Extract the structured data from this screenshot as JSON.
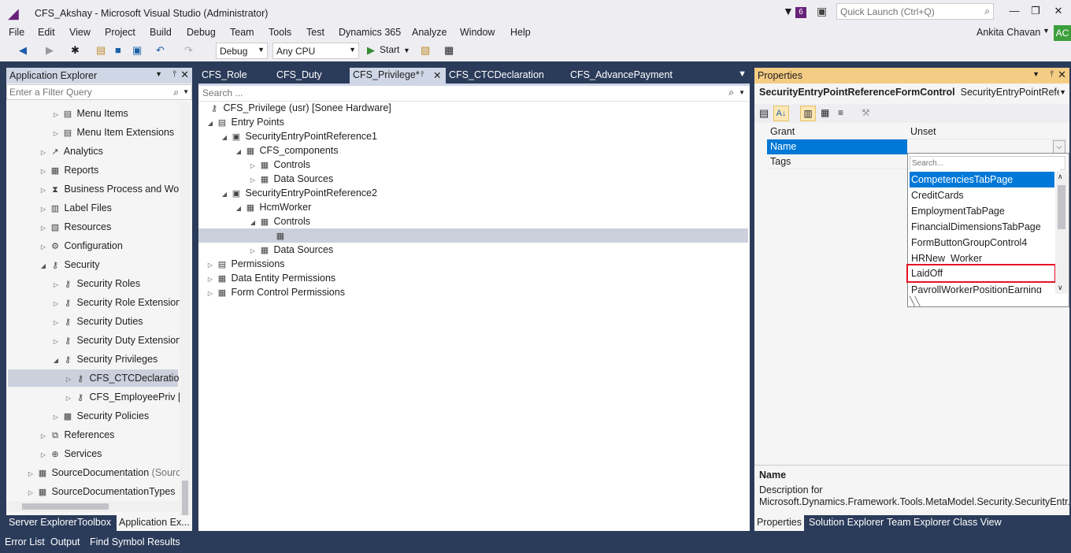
{
  "window": {
    "title": "CFS_Akshay - Microsoft Visual Studio (Administrator)",
    "notification_count": "6",
    "quick_launch_placeholder": "Quick Launch (Ctrl+Q)"
  },
  "menu": [
    "File",
    "Edit",
    "View",
    "Project",
    "Build",
    "Debug",
    "Team",
    "Tools",
    "Test",
    "Dynamics 365",
    "Analyze",
    "Window",
    "Help"
  ],
  "user": {
    "name": "Ankita Chavan",
    "initials": "AC"
  },
  "toolbar": {
    "config": "Debug",
    "platform": "Any CPU",
    "start": "Start"
  },
  "app_explorer": {
    "title": "Application Explorer",
    "filter_placeholder": "Enter a Filter Query",
    "items": [
      {
        "label": "Menu Items"
      },
      {
        "label": "Menu Item Extensions"
      },
      {
        "label": "Analytics"
      },
      {
        "label": "Reports"
      },
      {
        "label": "Business Process and Work"
      },
      {
        "label": "Label Files"
      },
      {
        "label": "Resources"
      },
      {
        "label": "Configuration"
      },
      {
        "label": "Security"
      },
      {
        "label": "Security Roles"
      },
      {
        "label": "Security Role Extensions"
      },
      {
        "label": "Security Duties"
      },
      {
        "label": "Security Duty Extensions"
      },
      {
        "label": "Security Privileges"
      },
      {
        "label": "CFS_CTCDeclaration"
      },
      {
        "label": "CFS_EmployeePriv"
      },
      {
        "label": "Security Policies"
      },
      {
        "label": "References"
      },
      {
        "label": "Services"
      },
      {
        "label": "SourceDocumentation",
        "suffix": "(Sourc"
      },
      {
        "label": "SourceDocumentationTypes"
      }
    ],
    "bottom_tabs": [
      "Server Explorer",
      "Toolbox",
      "Application Ex..."
    ]
  },
  "editor": {
    "tabs": [
      "CFS_Role",
      "CFS_Duty",
      "CFS_Privilege*",
      "CFS_CTCDeclaration",
      "CFS_AdvancePayment"
    ],
    "search_placeholder": "Search ...",
    "tree": [
      {
        "label": "CFS_Privilege (usr) [Sonee Hardware]"
      },
      {
        "label": "Entry Points"
      },
      {
        "label": "SecurityEntryPointReference1"
      },
      {
        "label": "CFS_components"
      },
      {
        "label": "Controls"
      },
      {
        "label": "Data Sources"
      },
      {
        "label": "SecurityEntryPointReference2"
      },
      {
        "label": "HcmWorker"
      },
      {
        "label": "Controls"
      },
      {
        "label": ""
      },
      {
        "label": "Data Sources"
      },
      {
        "label": "Permissions"
      },
      {
        "label": "Data Entity Permissions"
      },
      {
        "label": "Form Control Permissions"
      }
    ]
  },
  "properties": {
    "title": "Properties",
    "object_name": "SecurityEntryPointReferenceFormControl",
    "object_type": "SecurityEntryPointReferenc",
    "rows": [
      {
        "key": "Grant",
        "value": "Unset"
      },
      {
        "key": "Name",
        "value": ""
      },
      {
        "key": "Tags",
        "value": ""
      }
    ],
    "dropdown_search_placeholder": "Search...",
    "options": [
      "CompetenciesTabPage",
      "CreditCards",
      "EmploymentTabPage",
      "FinancialDimensionsTabPage",
      "FormButtonGroupControl4",
      "HRNew_Worker",
      "LaidOff",
      "PayrollWorkerPositionEarning"
    ],
    "desc_title": "Name",
    "desc_text": "Description for Microsoft.Dynamics.Framework.Tools.MetaModel.Security.SecurityEntr...",
    "bottom_tabs": [
      "Properties",
      "Solution Explorer",
      "Team Explorer",
      "Class View"
    ]
  },
  "status_tabs": [
    "Error List",
    "Output",
    "Find Symbol Results"
  ]
}
